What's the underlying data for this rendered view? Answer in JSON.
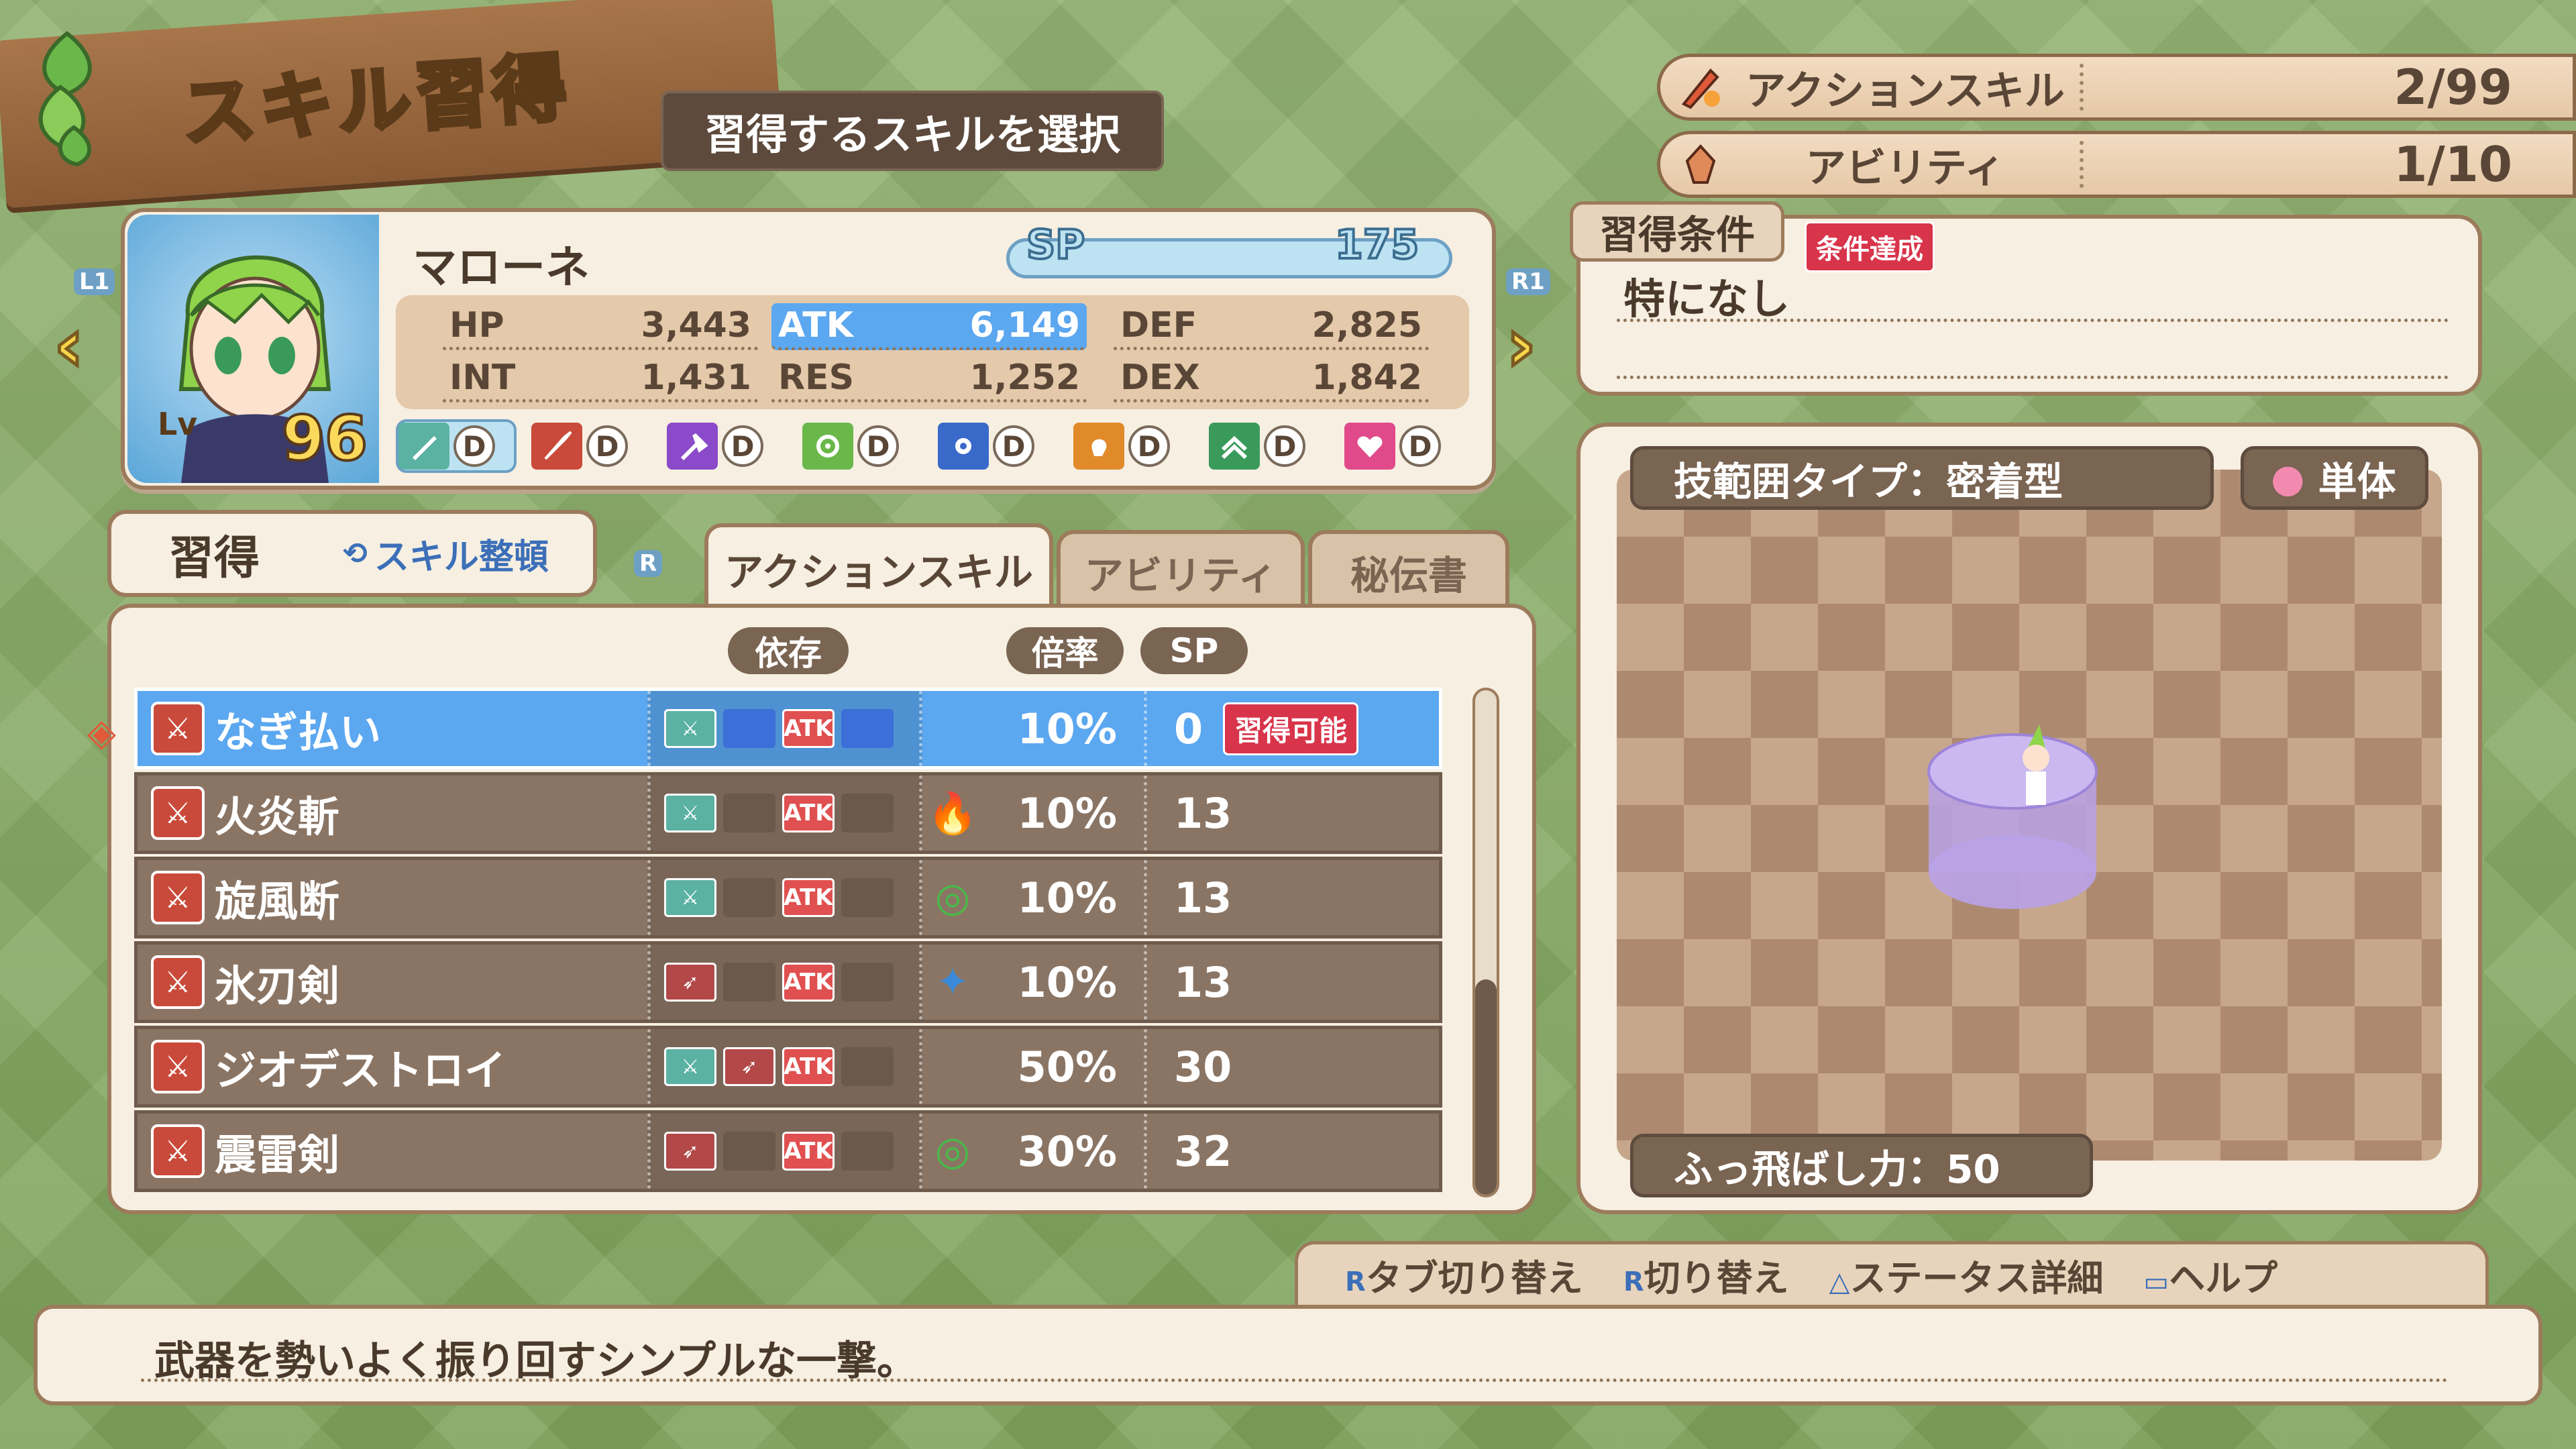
{
  "header": {
    "title": "スキル習得",
    "subtitle": "習得するスキルを選択"
  },
  "counts": [
    {
      "label": "アクションスキル",
      "value": "2/99",
      "icon": "flame-sword-icon"
    },
    {
      "label": "アビリティ",
      "value": "1/10",
      "icon": "ability-icon"
    }
  ],
  "character": {
    "name": "マローネ",
    "level_label": "Lv",
    "level": "96",
    "sp_label": "SP",
    "sp": "175",
    "nav_left": "L1",
    "nav_right": "R1",
    "stats": [
      {
        "key": "HP",
        "value": "3,443"
      },
      {
        "key": "ATK",
        "value": "6,149",
        "highlight": true
      },
      {
        "key": "DEF",
        "value": "2,825"
      },
      {
        "key": "INT",
        "value": "1,431"
      },
      {
        "key": "RES",
        "value": "1,252"
      },
      {
        "key": "DEX",
        "value": "1,842"
      }
    ],
    "weapons": [
      {
        "icon": "sword-icon",
        "rank": "D",
        "color": "#5bb2a2"
      },
      {
        "icon": "spear-icon",
        "rank": "D",
        "color": "#c94a3a"
      },
      {
        "icon": "axe-icon",
        "rank": "D",
        "color": "#8a4ac9"
      },
      {
        "icon": "bow-icon",
        "rank": "D",
        "color": "#6ab84a"
      },
      {
        "icon": "gun-icon",
        "rank": "D",
        "color": "#3a6ac9"
      },
      {
        "icon": "fist-icon",
        "rank": "D",
        "color": "#e08a2a"
      },
      {
        "icon": "staff-icon",
        "rank": "D",
        "color": "#3a9a5a"
      },
      {
        "icon": "heart-icon",
        "rank": "D",
        "color": "#e04a8a"
      }
    ]
  },
  "learn_box": {
    "label": "習得",
    "sort_label": "スキル整頓"
  },
  "tabs": [
    {
      "label": "アクションスキル",
      "active": true
    },
    {
      "label": "アビリティ",
      "active": false
    },
    {
      "label": "秘伝書",
      "active": false
    }
  ],
  "tab_switch_key": "R",
  "list_headers": {
    "dependency": "依存",
    "rate": "倍率",
    "sp": "SP"
  },
  "skills": [
    {
      "name": "なぎ払い",
      "deps": [
        "w",
        "",
        "ATK",
        ""
      ],
      "element": "",
      "rate": "10%",
      "sp": "0",
      "badge": "習得可能",
      "selected": true
    },
    {
      "name": "火炎斬",
      "deps": [
        "w",
        "",
        "ATK",
        ""
      ],
      "element": "fire-icon",
      "rate": "10%",
      "sp": "13"
    },
    {
      "name": "旋風断",
      "deps": [
        "w",
        "",
        "ATK",
        ""
      ],
      "element": "wind-icon",
      "rate": "10%",
      "sp": "13"
    },
    {
      "name": "氷刃剣",
      "deps": [
        "r",
        "",
        "ATK",
        ""
      ],
      "element": "ice-icon",
      "rate": "10%",
      "sp": "13"
    },
    {
      "name": "ジオデストロイ",
      "deps": [
        "w",
        "r",
        "ATK",
        ""
      ],
      "element": "",
      "rate": "50%",
      "sp": "30"
    },
    {
      "name": "震雷剣",
      "deps": [
        "r",
        "",
        "ATK",
        ""
      ],
      "element": "wind-icon",
      "rate": "30%",
      "sp": "32"
    }
  ],
  "condition": {
    "tab_label": "習得条件",
    "status": "条件達成",
    "text": "特になし"
  },
  "preview": {
    "range_type": "技範囲タイプ：密着型",
    "target": "単体",
    "knockback": "ふっ飛ばし力：50"
  },
  "help": [
    {
      "key": "R",
      "label": "タブ切り替え"
    },
    {
      "key": "R",
      "label": "切り替え"
    },
    {
      "key": "△",
      "label": "ステータス詳細"
    },
    {
      "key": "▭",
      "label": "ヘルプ"
    }
  ],
  "description": "武器を勢いよく振り回すシンプルな一撃。"
}
